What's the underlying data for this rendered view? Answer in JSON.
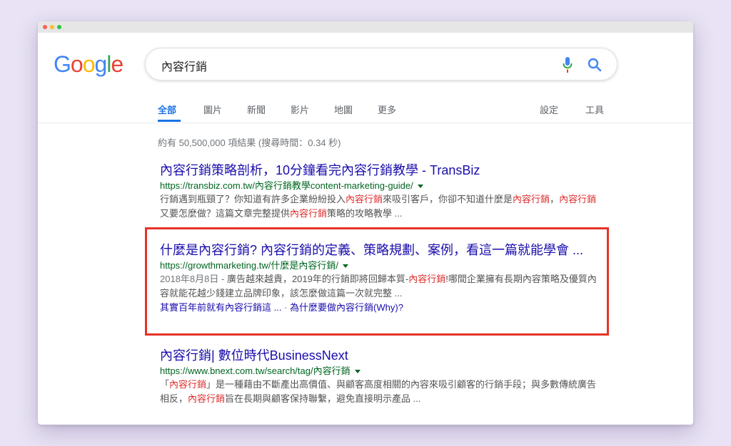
{
  "logo": {
    "text": "Google"
  },
  "search": {
    "query": "內容行銷"
  },
  "tabs": {
    "items": [
      "全部",
      "圖片",
      "新聞",
      "影片",
      "地圖",
      "更多"
    ],
    "settings": "設定",
    "tools": "工具"
  },
  "stats": "約有 50,500,000 項結果 (搜尋時間：0.34 秒)",
  "results": [
    {
      "title": "內容行銷策略剖析，10分鐘看完內容行銷教學 - TransBiz",
      "url": "https://transbiz.com.tw/內容行銷教學content-marketing-guide/",
      "snippet": [
        {
          "t": "行銷遇到瓶頸了？你知道有許多企業紛紛投入",
          "hl": false
        },
        {
          "t": "內容行銷",
          "hl": true
        },
        {
          "t": "來吸引客戶，你卻不知道什麼是",
          "hl": false
        },
        {
          "t": "內容行銷",
          "hl": true
        },
        {
          "t": "，",
          "hl": false
        },
        {
          "t": "內容行銷",
          "hl": true
        },
        {
          "t": "又要怎麼做？這篇文章完整提供",
          "hl": false
        },
        {
          "t": "內容行銷",
          "hl": true
        },
        {
          "t": "策略的攻略教學 ...",
          "hl": false
        }
      ]
    },
    {
      "title": "什麼是內容行銷? 內容行銷的定義、策略規劃、案例，看這一篇就能學會 ...",
      "url": "https://growthmarketing.tw/什麼是內容行銷/",
      "date": "2018年8月8日 - ",
      "snippet": [
        {
          "t": "廣告越來越貴，2019年的行銷即將回歸本質-",
          "hl": false
        },
        {
          "t": "內容行銷",
          "hl": true
        },
        {
          "t": "!哪間企業擁有長期內容策略及優質內容就能花越少錢建立品牌印象，該怎麼做這篇一次就完整 ...",
          "hl": false
        }
      ],
      "links": [
        "其實百年前就有內容行銷這 ...",
        "為什麼要做內容行銷(Why)?"
      ]
    },
    {
      "title": "內容行銷| 數位時代BusinessNext",
      "url": "https://www.bnext.com.tw/search/tag/內容行銷",
      "snippet": [
        {
          "t": "「",
          "hl": false
        },
        {
          "t": "內容行銷",
          "hl": true
        },
        {
          "t": "」是一種藉由不斷產出高價值、與顧客高度相關的內容來吸引顧客的行銷手段；與多數傳統廣告相反，",
          "hl": false
        },
        {
          "t": "內容行銷",
          "hl": true
        },
        {
          "t": "旨在長期與顧客保持聯繫，避免直接明示產品 ...",
          "hl": false
        }
      ]
    }
  ],
  "colors": {
    "link": "#1a0dab",
    "url": "#006621",
    "highlight": "#dd2c2c",
    "accent": "#1a73e8",
    "annotation": "#e53327"
  },
  "icons": {
    "mic": "microphone-icon",
    "search": "search-icon"
  }
}
